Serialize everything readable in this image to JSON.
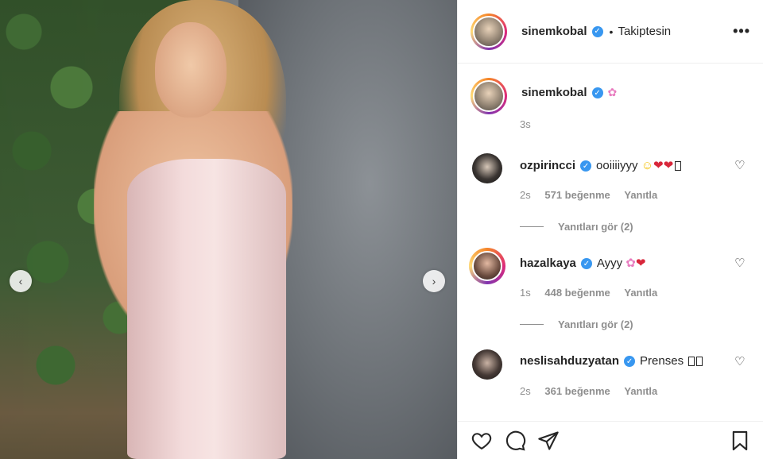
{
  "post": {
    "author": "sinemkobal",
    "follow_status": "Takiptesin",
    "more_icon": "•••",
    "caption_emoji": "✿",
    "caption_time": "3s"
  },
  "photo": {
    "prev_icon": "‹",
    "next_icon": "›"
  },
  "comments": [
    {
      "user": "ozpirincci",
      "text": "ooiiiiyyy",
      "emojis": [
        "☺",
        "❤",
        "❤"
      ],
      "time": "2s",
      "likes": "571 beğenme",
      "reply": "Yanıtla",
      "view_replies": "Yanıtları gör (2)"
    },
    {
      "user": "hazalkaya",
      "text": "Ayyy",
      "emojis": [
        "✿",
        "❤"
      ],
      "time": "1s",
      "likes": "448 beğenme",
      "reply": "Yanıtla",
      "view_replies": "Yanıtları gör (2)"
    },
    {
      "user": "neslisahduzyatan",
      "text": "Prenses",
      "time": "2s",
      "likes": "361 beğenme",
      "reply": "Yanıtla"
    }
  ],
  "icons": {
    "like": "heart-outline-icon",
    "comment": "speech-bubble-icon",
    "share": "paper-plane-icon",
    "save": "bookmark-icon",
    "verified": "✓",
    "comment_like": "♡"
  },
  "colors": {
    "verified_blue": "#3897f0",
    "secondary_text": "#8e8e8e",
    "primary_text": "#262626"
  }
}
